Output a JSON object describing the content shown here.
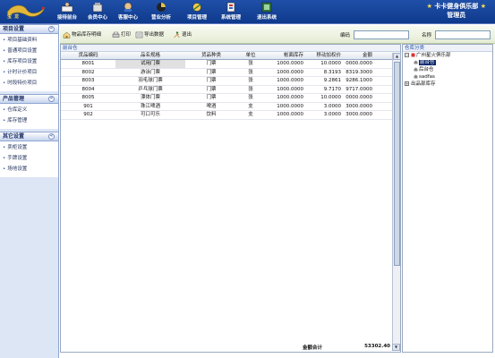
{
  "app": {
    "logo_text": "宝龙",
    "brand_line1": "卡卡健身俱乐部",
    "brand_line2": "管理员"
  },
  "nav": [
    {
      "label": "接待前台",
      "icon": "reception-icon"
    },
    {
      "label": "会员中心",
      "icon": "member-icon"
    },
    {
      "label": "客服中心",
      "icon": "service-icon"
    },
    {
      "label": "营业分析",
      "icon": "analysis-icon"
    },
    {
      "label": "项目管理",
      "icon": "project-icon"
    },
    {
      "label": "系统管理",
      "icon": "system-icon"
    },
    {
      "label": "退出系统",
      "icon": "exit-icon"
    }
  ],
  "sidebar": {
    "sections": [
      {
        "title": "项目设置",
        "items": [
          "项目基础资料",
          "普通项目设置",
          "库存项目设置",
          "计时计价项目",
          "时段特价项目"
        ]
      },
      {
        "title": "产品管理",
        "items": [
          "仓库定义",
          "库存管理"
        ]
      },
      {
        "title": "其它设置",
        "items": [
          "卖柜设置",
          "手牌设置",
          "场地设置"
        ]
      }
    ]
  },
  "toolbar": {
    "detail_label": "物品库存明细",
    "print_label": "打印",
    "export_label": "导出数据",
    "exit_label": "退出",
    "code_label": "编码",
    "code_value": "",
    "name_label": "名称",
    "name_value": ""
  },
  "grid": {
    "title": "前台仓",
    "columns": [
      "货品编码",
      "品名规格",
      "货品种类",
      "单位",
      "帐面库存",
      "移动加权价",
      "金额"
    ],
    "rows": [
      [
        "8001",
        "试用门票",
        "门票",
        "张",
        "1000.0000",
        "10.0000",
        "0000.0000"
      ],
      [
        "8002",
        "游泳门票",
        "门票",
        "张",
        "1000.0000",
        "8.3193",
        "8319.3000"
      ],
      [
        "8003",
        "羽毛球门票",
        "门票",
        "张",
        "1000.0000",
        "9.2861",
        "9286.1000"
      ],
      [
        "8004",
        "乒乓球门票",
        "门票",
        "张",
        "1000.0000",
        "9.7170",
        "9717.0000"
      ],
      [
        "8005",
        "漂体门票",
        "门票",
        "张",
        "1000.0000",
        "10.0000",
        "0000.0000"
      ],
      [
        "901",
        "珠江啤酒",
        "啤酒",
        "支",
        "1000.0000",
        "3.0000",
        "3000.0000"
      ],
      [
        "902",
        "可口可乐",
        "饮料",
        "支",
        "1000.0000",
        "3.0000",
        "3000.0000"
      ]
    ],
    "total_label": "金额合计",
    "total_value": "53302.40"
  },
  "tree": {
    "title": "仓库分类",
    "root": "广州星火俱乐部",
    "children": [
      "前台仓",
      "后台仓",
      "sadfas"
    ],
    "other": "出品部库存",
    "selected": "前台仓"
  },
  "colors": {
    "topbar": "#1f4fa8",
    "brand_star": "#ffe04a",
    "selection": "#0a246a"
  }
}
